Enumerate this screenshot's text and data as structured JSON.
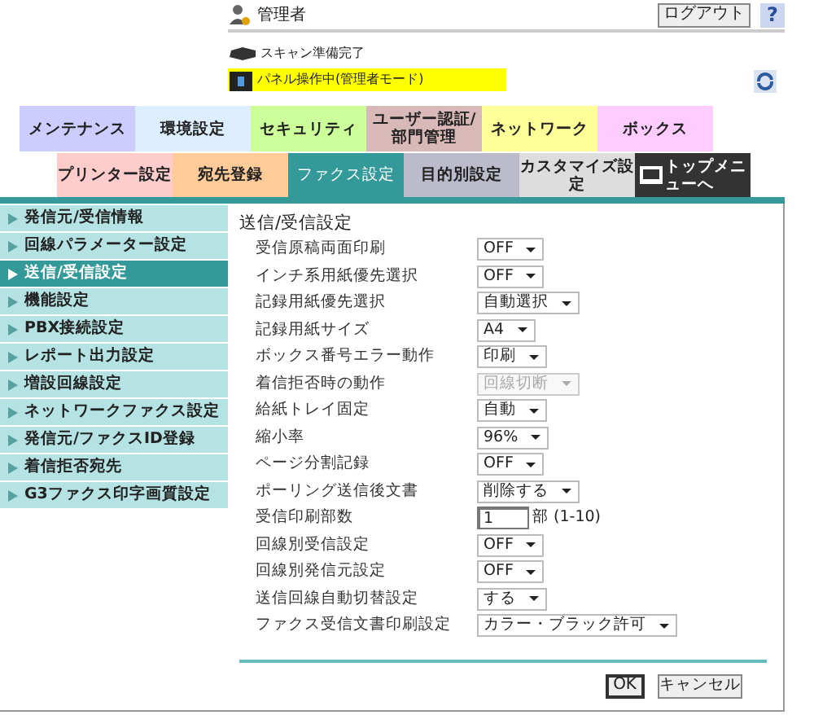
{
  "header": {
    "user": "管理者",
    "logout": "ログアウト",
    "help": "?"
  },
  "status": {
    "scan": "スキャン準備完了",
    "panel": "パネル操作中(管理者モード)"
  },
  "main_tabs": [
    {
      "label": "メンテナンス",
      "color": "#ccccff",
      "selected": false
    },
    {
      "label": "環境設定",
      "color": "#ddeeff",
      "selected": false
    },
    {
      "label": "セキュリティ",
      "color": "#ccff99",
      "selected": false
    },
    {
      "label": "ユーザー認証/部門管理",
      "color": "#d9b8b8",
      "selected": false
    },
    {
      "label": "ネットワーク",
      "color": "#ffff99",
      "selected": false
    },
    {
      "label": "ボックス",
      "color": "#ffccff",
      "selected": false
    }
  ],
  "sub_tabs": [
    {
      "label": "プリンター設定",
      "color": "#ffcccc",
      "selected": false
    },
    {
      "label": "宛先登録",
      "color": "#ffcc99",
      "selected": false
    },
    {
      "label": "ファクス設定",
      "color": "#339999",
      "selected": true
    },
    {
      "label": "目的別設定",
      "color": "#bbbbcc",
      "selected": false
    },
    {
      "label": "カスタマイズ設定",
      "color": "#dddddd",
      "selected": false
    },
    {
      "label": "トップメニューへ",
      "color": "#333333",
      "selected": false
    }
  ],
  "sidebar": {
    "items": [
      {
        "label": "発信元/受信情報",
        "selected": false
      },
      {
        "label": "回線パラメーター設定",
        "selected": false
      },
      {
        "label": "送信/受信設定",
        "selected": true
      },
      {
        "label": "機能設定",
        "selected": false
      },
      {
        "label": "PBX接続設定",
        "selected": false
      },
      {
        "label": "レポート出力設定",
        "selected": false
      },
      {
        "label": "増設回線設定",
        "selected": false
      },
      {
        "label": "ネットワークファクス設定",
        "selected": false
      },
      {
        "label": "発信元/ファクスID登録",
        "selected": false
      },
      {
        "label": "着信拒否宛先",
        "selected": false
      },
      {
        "label": "G3ファクス印字画質設定",
        "selected": false
      }
    ]
  },
  "form": {
    "title": "送信/受信設定",
    "rows": [
      {
        "label": "受信原稿両面印刷",
        "kind": "select",
        "value": "OFF",
        "disabled": false
      },
      {
        "label": "インチ系用紙優先選択",
        "kind": "select",
        "value": "OFF",
        "disabled": false
      },
      {
        "label": "記録用紙優先選択",
        "kind": "select",
        "value": "自動選択",
        "disabled": false
      },
      {
        "label": "記録用紙サイズ",
        "kind": "select",
        "value": "A4",
        "disabled": false
      },
      {
        "label": "ボックス番号エラー動作",
        "kind": "select",
        "value": "印刷",
        "disabled": false
      },
      {
        "label": "着信拒否時の動作",
        "kind": "select",
        "value": "回線切断",
        "disabled": true
      },
      {
        "label": "給紙トレイ固定",
        "kind": "select",
        "value": "自動",
        "disabled": false
      },
      {
        "label": "縮小率",
        "kind": "select",
        "value": "96%",
        "disabled": false
      },
      {
        "label": "ページ分割記録",
        "kind": "select",
        "value": "OFF",
        "disabled": false
      },
      {
        "label": "ポーリング送信後文書",
        "kind": "select",
        "value": "削除する",
        "disabled": false
      },
      {
        "label": "受信印刷部数",
        "kind": "number",
        "value": "1",
        "suffix": "部 (1-10)"
      },
      {
        "label": "回線別受信設定",
        "kind": "select",
        "value": "OFF",
        "disabled": false
      },
      {
        "label": "回線別発信元設定",
        "kind": "select",
        "value": "OFF",
        "disabled": false
      },
      {
        "label": "送信回線自動切替設定",
        "kind": "select",
        "value": "する",
        "disabled": false
      },
      {
        "label": "ファクス受信文書印刷設定",
        "kind": "select",
        "value": "カラー・ブラック許可",
        "disabled": false
      }
    ],
    "buttons": [
      "OK",
      "キャンセル"
    ]
  }
}
